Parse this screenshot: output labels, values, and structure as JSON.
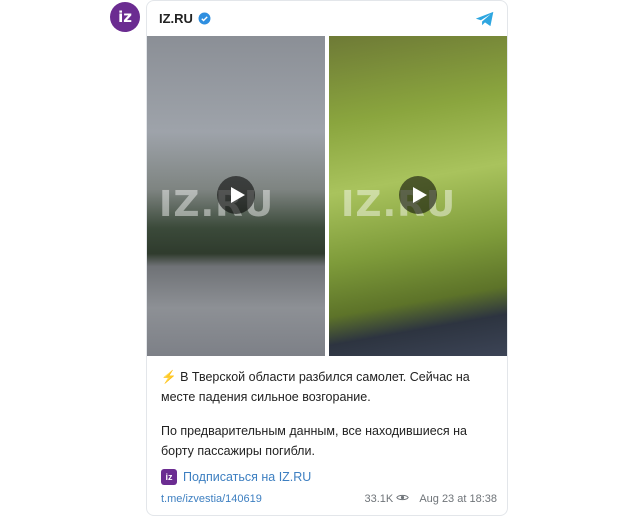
{
  "channel": {
    "name": "IZ.RU",
    "avatar_text": "iz",
    "verified": true,
    "brand_color": "#6b2c91"
  },
  "media": [
    {
      "watermark": "IZ.RU",
      "icon": "play-icon"
    },
    {
      "watermark": "IZ.RU",
      "icon": "play-icon"
    }
  ],
  "post": {
    "emoji": "⚡",
    "paragraph1": "В Тверской области разбился самолет. Сейчас на месте падения сильное возгорание.",
    "paragraph2": "По предварительным данным, все находившиеся на борту пассажиры погибли."
  },
  "subscribe": {
    "icon_text": "iz",
    "label": "Подписаться на IZ.RU"
  },
  "footer": {
    "link": "t.me/izvestia/140619",
    "views": "33.1K",
    "date": "Aug 23 at 18:38"
  },
  "colors": {
    "link": "#3d7fc1",
    "accent": "#8b3fd1"
  }
}
